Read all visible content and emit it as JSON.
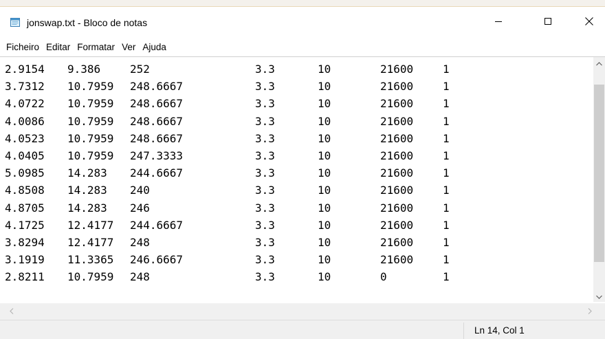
{
  "window": {
    "title": "jonswap.txt - Bloco de notas",
    "app_icon": "notepad-icon",
    "controls": {
      "minimize_icon": "minimize-icon",
      "maximize_icon": "maximize-icon",
      "close_icon": "close-icon"
    }
  },
  "menubar": {
    "items": [
      {
        "label": "Ficheiro"
      },
      {
        "label": "Editar"
      },
      {
        "label": "Formatar"
      },
      {
        "label": "Ver"
      },
      {
        "label": "Ajuda"
      }
    ]
  },
  "editor": {
    "rows": [
      [
        "2.9154",
        "9.386",
        "252",
        "3.3",
        "10",
        "21600",
        "1"
      ],
      [
        "3.7312",
        "10.7959",
        "248.6667",
        "3.3",
        "10",
        "21600",
        "1"
      ],
      [
        "4.0722",
        "10.7959",
        "248.6667",
        "3.3",
        "10",
        "21600",
        "1"
      ],
      [
        "4.0086",
        "10.7959",
        "248.6667",
        "3.3",
        "10",
        "21600",
        "1"
      ],
      [
        "4.0523",
        "10.7959",
        "248.6667",
        "3.3",
        "10",
        "21600",
        "1"
      ],
      [
        "4.0405",
        "10.7959",
        "247.3333",
        "3.3",
        "10",
        "21600",
        "1"
      ],
      [
        "5.0985",
        "14.283",
        "244.6667",
        "3.3",
        "10",
        "21600",
        "1"
      ],
      [
        "4.8508",
        "14.283",
        "240",
        "3.3",
        "10",
        "21600",
        "1"
      ],
      [
        "4.8705",
        "14.283",
        "246",
        "3.3",
        "10",
        "21600",
        "1"
      ],
      [
        "4.1725",
        "12.4177",
        "244.6667",
        "3.3",
        "10",
        "21600",
        "1"
      ],
      [
        "3.8294",
        "12.4177",
        "248",
        "3.3",
        "10",
        "21600",
        "1"
      ],
      [
        "3.1919",
        "11.3365",
        "246.6667",
        "3.3",
        "10",
        "21600",
        "1"
      ],
      [
        "2.8211",
        "10.7959",
        "248",
        "3.3",
        "10",
        "0",
        "1"
      ]
    ]
  },
  "statusbar": {
    "position": "Ln 14, Col 1"
  }
}
